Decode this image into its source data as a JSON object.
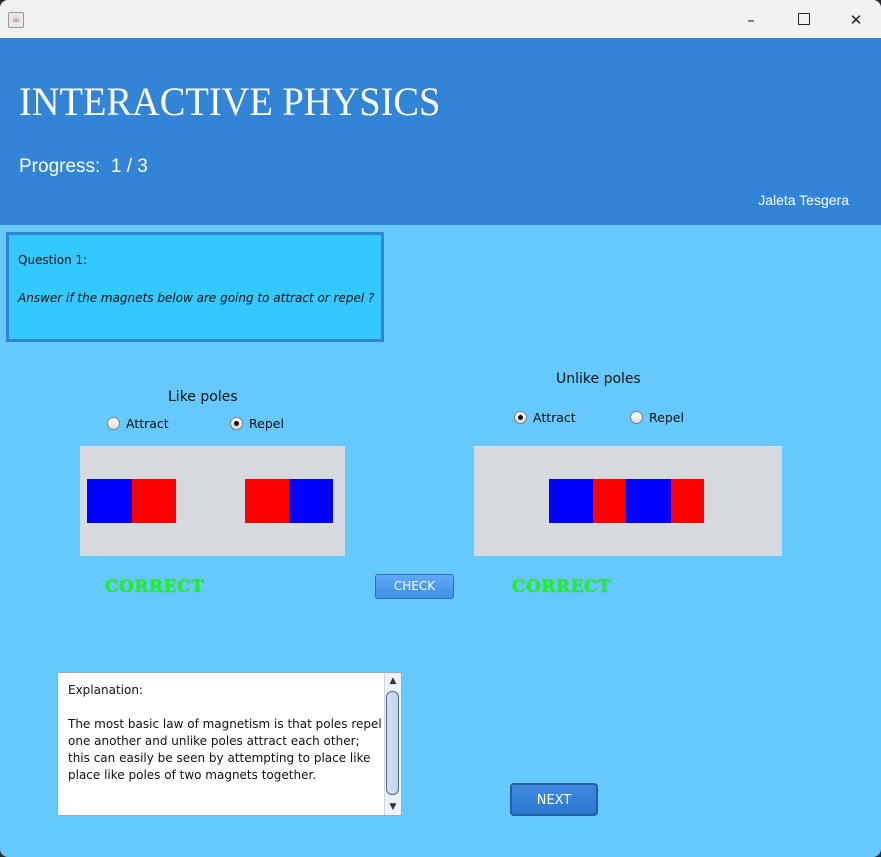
{
  "window": {
    "app_icon": "java-cup-icon",
    "controls": {
      "minimize": "–",
      "close": "✕"
    }
  },
  "header": {
    "title": "INTERACTIVE PHYSICS",
    "progress_label": "Progress:",
    "progress_value": "1 / 3",
    "progress": {
      "current": 1,
      "total": 3
    },
    "user_name": "Jaleta Tesgera"
  },
  "question": {
    "label": "Question 1:",
    "text": "Answer if the magnets below are going to attract or repel ?"
  },
  "groups": [
    {
      "title": "Like poles",
      "options": [
        {
          "label": "Attract",
          "selected": false
        },
        {
          "label": "Repel",
          "selected": true
        }
      ],
      "magnets": [
        [
          "blue",
          "red"
        ],
        [
          "red",
          "blue"
        ]
      ],
      "result": "CORRECT"
    },
    {
      "title": "Unlike poles",
      "options": [
        {
          "label": "Attract",
          "selected": true
        },
        {
          "label": "Repel",
          "selected": false
        }
      ],
      "magnets": [
        [
          "blue",
          "red"
        ],
        [
          "blue",
          "red"
        ]
      ],
      "result": "CORRECT"
    }
  ],
  "buttons": {
    "check": "CHECK",
    "next": "NEXT"
  },
  "explanation": {
    "text": "Explanation:\n\nThe most basic law of magnetism is that poles repel one another and unlike poles attract each other; this can easily be seen by attempting to place like place like poles of two magnets together."
  },
  "colors": {
    "header_bg": "#3184d6",
    "body_bg": "#66c9fd",
    "question_bg": "#33c9fe",
    "north": "#0000ff",
    "south": "#ff0000",
    "correct": "#1ef21e"
  }
}
